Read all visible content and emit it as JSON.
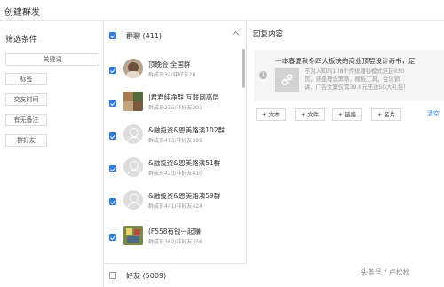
{
  "window": {
    "title": "创建群发"
  },
  "filters": {
    "title": "筛选条件",
    "keyword_button": "关键词",
    "tag_button": "标签",
    "friend_time_button": "交友时间",
    "has_remark_button": "有无备注",
    "group_friend_button": "群好友"
  },
  "group_list": {
    "header": "群聊 (411)",
    "rows": [
      {
        "name": "顶晚会 全国群",
        "meta": "群成员32/非好友28",
        "avatar": "photo-a"
      },
      {
        "name": "|君君纯净群 互联网高层",
        "meta": "群成员215/非好友201",
        "avatar": "photo-b"
      },
      {
        "name": "&融投资&恩美路演102群",
        "meta": "群成员413/非好友399",
        "avatar": "default"
      },
      {
        "name": "&融投资&恩美路演51群",
        "meta": "群成员423/非好友410",
        "avatar": "default"
      },
      {
        "name": "&融投资&恩美路演59群",
        "meta": "群成员441/非好友424",
        "avatar": "default"
      },
      {
        "name": "(F558有钱一起赚",
        "meta": "群成员362/非好友356",
        "avatar": "photo-c"
      }
    ],
    "friends_label": "好友 (5009)"
  },
  "reply": {
    "title": "回复内容",
    "item_number": "1",
    "headline": "一本春夏秋冬四大板块的商业顶层设计奇书，足",
    "desc_lines": [
      "不为人知的108个传统赚钱模式足足930",
      "页，涵盖理念策略，模板工具，会议销",
      "讲，广告文案仅需39.8元还送5G大礼包！"
    ],
    "buttons": [
      "+ 文本",
      "+ 文件",
      "+ 链接",
      "+ 名片"
    ],
    "clear": "清空"
  },
  "watermark": "头条号 / 卢松松",
  "colors": {
    "accent": "#2f7be0",
    "border": "#e3e3e3",
    "muted": "#999999"
  },
  "icons": {
    "checkbox": "checkbox-checked-icon",
    "link": "link-icon",
    "avatar": "default-avatar-icon",
    "collapse": "chevron-up-icon"
  }
}
